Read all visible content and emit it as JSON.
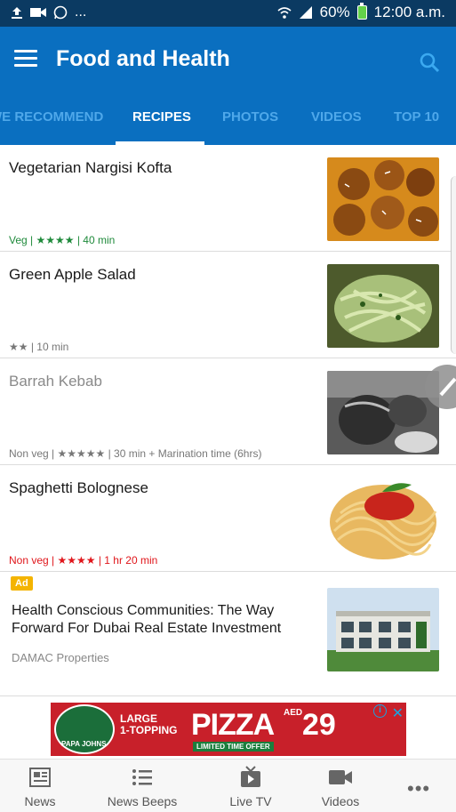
{
  "status_bar": {
    "left_icons": [
      "upload-icon",
      "video-icon",
      "whatsapp-icon"
    ],
    "overflow": "...",
    "battery": "60%",
    "time": "12:00 a.m."
  },
  "app_bar": {
    "title": "Food and Health",
    "tabs": [
      {
        "label": "WE RECOMMEND",
        "active": false
      },
      {
        "label": "RECIPES",
        "active": true
      },
      {
        "label": "PHOTOS",
        "active": false
      },
      {
        "label": "VIDEOS",
        "active": false
      },
      {
        "label": "TOP 10",
        "active": false
      }
    ]
  },
  "recipes": [
    {
      "title": "Vegetarian Nargisi Kofta",
      "meta": "Veg | ★★★★ | 40 min",
      "meta_color": "#1f8a3b"
    },
    {
      "title": "Green Apple Salad",
      "meta": "★★ | 10 min",
      "meta_color": "#777777"
    },
    {
      "title": "Barrah Kebab",
      "meta": "Non veg | ★★★★★ | 30 min + Marination time (6hrs)",
      "meta_color": "#8a8a8a"
    },
    {
      "title": "Spaghetti Bolognese",
      "meta": "Non veg | ★★★★ | 1 hr 20 min",
      "meta_color": "#e0161b"
    }
  ],
  "ad": {
    "badge": "Ad",
    "title": "Health Conscious Communities: The Way Forward For Dubai Real Estate Investment",
    "source": "DAMAC Properties"
  },
  "banner": {
    "line1": "LARGE",
    "line2": "1-TOPPING",
    "headline": "PIZZA",
    "currency": "AED",
    "price": "29",
    "small": "LIMITED TIME OFFER",
    "brand": "PAPA JOHNS"
  },
  "bottom_nav": [
    {
      "label": "News",
      "icon": "newspaper-icon"
    },
    {
      "label": "News Beeps",
      "icon": "list-icon"
    },
    {
      "label": "Live TV",
      "icon": "tv-icon"
    },
    {
      "label": "Videos",
      "icon": "video-camera-icon"
    }
  ],
  "more": "•••"
}
